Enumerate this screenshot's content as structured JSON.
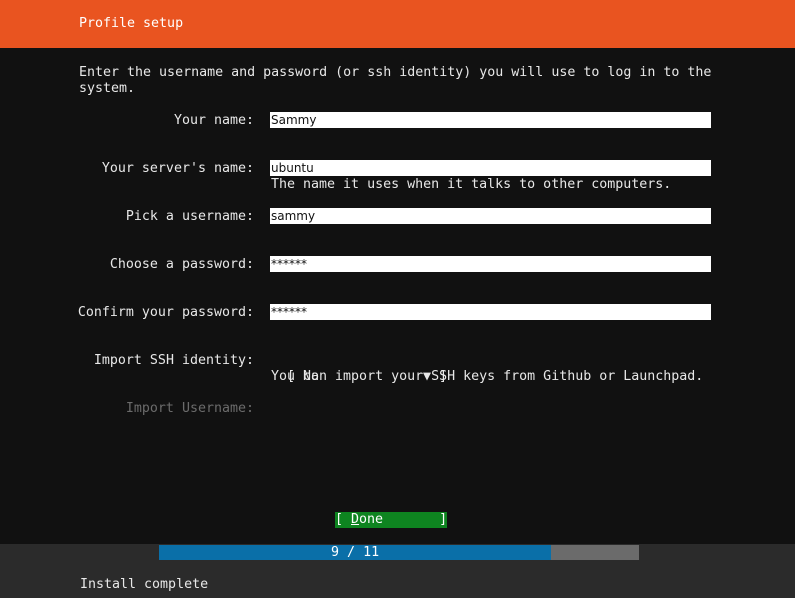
{
  "header": {
    "title": "Profile setup"
  },
  "intro": "Enter the username and password (or ssh identity) you will use to log in to the\nsystem.",
  "form": {
    "your_name": {
      "label": "Your name:",
      "value": "Sammy"
    },
    "server_name": {
      "label": "Your server's name:",
      "value": "ubuntu",
      "help": "The name it uses when it talks to other computers."
    },
    "username": {
      "label": "Pick a username:",
      "value": "sammy"
    },
    "password": {
      "label": "Choose a password:",
      "value": "******"
    },
    "confirm_password": {
      "label": "Confirm your password:",
      "value": "******"
    },
    "ssh_identity": {
      "label": "Import SSH identity:",
      "open_bracket": "[ ",
      "value": "No",
      "arrow": "▼",
      "close_bracket": " ]",
      "help": "You can import your SSH keys from Github or Launchpad."
    },
    "import_username": {
      "label": "Import Username:"
    }
  },
  "done_button": {
    "open": "[ ",
    "accel": "D",
    "rest": "one",
    "close": "       ]"
  },
  "progress": {
    "text": "9 / 11",
    "current": 9,
    "total": 11,
    "fill_fraction": 0.817
  },
  "status": {
    "text": "Install complete"
  },
  "colors": {
    "accent": "#e95420",
    "background": "#111111",
    "button": "#0e8420",
    "progress": "#0a6fa8"
  }
}
